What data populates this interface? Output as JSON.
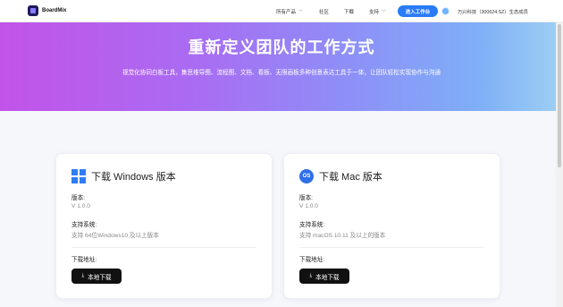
{
  "nav": {
    "brand": "BoardMix",
    "items": [
      {
        "label": "所有产品",
        "has_dropdown": true
      },
      {
        "label": "社区",
        "has_dropdown": false
      },
      {
        "label": "下载",
        "has_dropdown": false
      },
      {
        "label": "支持",
        "has_dropdown": true
      }
    ],
    "cta_label": "进入工作台",
    "user_label": "万兴科技（300624.SZ）生态成员"
  },
  "hero": {
    "title": "重新定义团队的工作方式",
    "subtitle": "视觉化协同白板工具，集思维导图、流程图、文档、看板、无限画板多种创意表达工具于一体，让团队轻松实现协作与沟通"
  },
  "cards": [
    {
      "platform": "windows",
      "icon": "windows-icon",
      "title": "下载 Windows 版本",
      "version_label": "版本:",
      "version_value": "V 1.0.0",
      "system_label": "支持系统:",
      "system_value": "支持 64位Windows10 及以上版本",
      "download_label": "下载地址:",
      "button_label": "本地下载"
    },
    {
      "platform": "mac",
      "icon": "macos-icon",
      "icon_text": "OS",
      "title": "下载 Mac 版本",
      "version_label": "版本:",
      "version_value": "V 1.0.0",
      "system_label": "支持系统:",
      "system_value": "支持 macOS 10.11 及以上的版本",
      "download_label": "下载地址:",
      "button_label": "本地下载"
    }
  ],
  "colors": {
    "accent": "#2a7bf6",
    "hero_gradient_start": "#c253e9",
    "hero_gradient_end": "#9fd0f3",
    "button_dark": "#111111"
  }
}
